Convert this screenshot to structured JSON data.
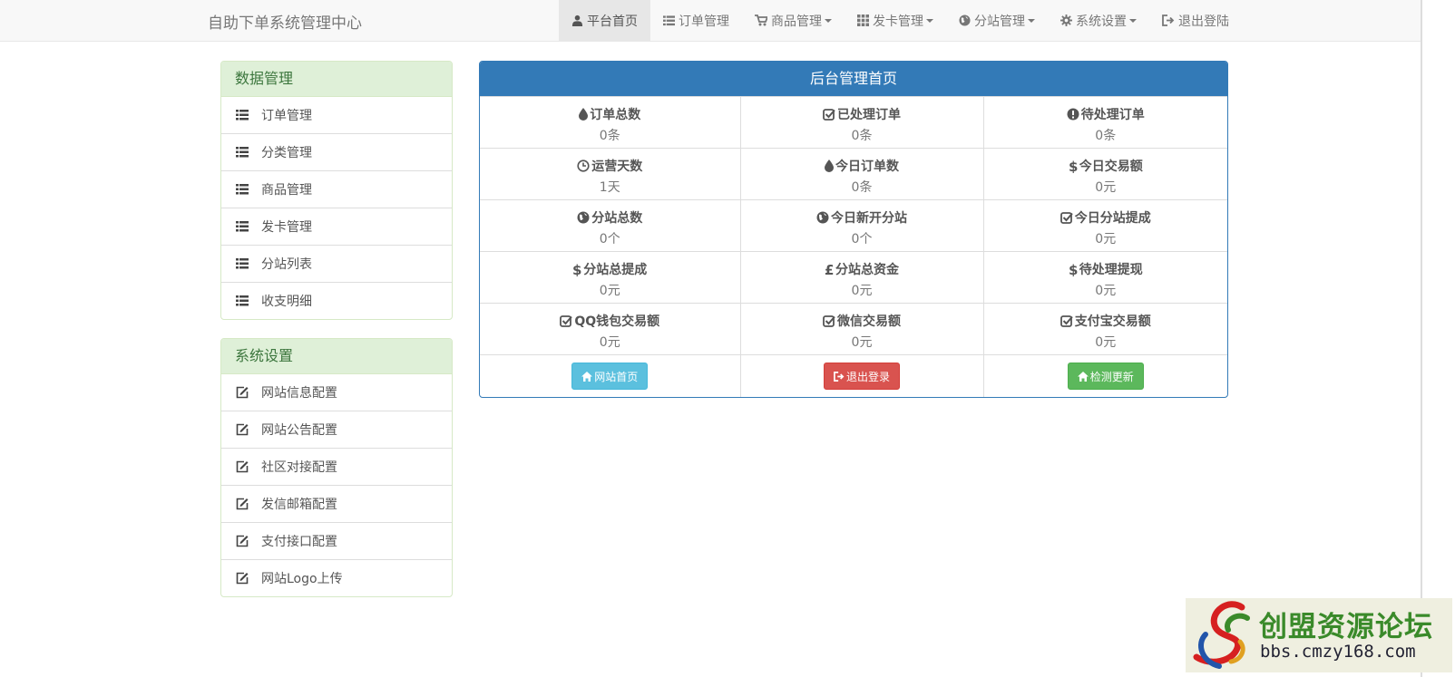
{
  "navbar": {
    "brand": "自助下单系统管理中心",
    "items": [
      {
        "label": "平台首页",
        "icon": "user-icon"
      },
      {
        "label": "订单管理",
        "icon": "list-icon"
      },
      {
        "label": "商品管理",
        "icon": "cart-icon"
      },
      {
        "label": "发卡管理",
        "icon": "grid-icon"
      },
      {
        "label": "分站管理",
        "icon": "globe-icon"
      },
      {
        "label": "系统设置",
        "icon": "gear-icon"
      },
      {
        "label": "退出登陆",
        "icon": "logout-icon"
      }
    ]
  },
  "sidebar": {
    "data_panel": {
      "title": "数据管理",
      "items": [
        {
          "label": "订单管理",
          "icon": "list-icon"
        },
        {
          "label": "分类管理",
          "icon": "list-icon"
        },
        {
          "label": "商品管理",
          "icon": "list-icon"
        },
        {
          "label": "发卡管理",
          "icon": "list-icon"
        },
        {
          "label": "分站列表",
          "icon": "list-icon"
        },
        {
          "label": "收支明细",
          "icon": "list-icon"
        }
      ]
    },
    "settings_panel": {
      "title": "系统设置",
      "items": [
        {
          "label": "网站信息配置",
          "icon": "edit-icon"
        },
        {
          "label": "网站公告配置",
          "icon": "edit-icon"
        },
        {
          "label": "社区对接配置",
          "icon": "edit-icon"
        },
        {
          "label": "发信邮箱配置",
          "icon": "edit-icon"
        },
        {
          "label": "支付接口配置",
          "icon": "edit-icon"
        },
        {
          "label": "网站Logo上传",
          "icon": "edit-icon"
        }
      ]
    }
  },
  "main": {
    "title": "后台管理首页",
    "rows": [
      [
        {
          "label": "订单总数",
          "value": "0条",
          "icon": "drop-icon"
        },
        {
          "label": "已处理订单",
          "value": "0条",
          "icon": "check-icon"
        },
        {
          "label": "待处理订单",
          "value": "0条",
          "icon": "info-icon"
        }
      ],
      [
        {
          "label": "运营天数",
          "value": "1天",
          "icon": "clock-icon"
        },
        {
          "label": "今日订单数",
          "value": "0条",
          "icon": "drop-icon"
        },
        {
          "label": "今日交易额",
          "value": "0元",
          "icon": "dollar-icon"
        }
      ],
      [
        {
          "label": "分站总数",
          "value": "0个",
          "icon": "globe-icon"
        },
        {
          "label": "今日新开分站",
          "value": "0个",
          "icon": "globe-icon"
        },
        {
          "label": "今日分站提成",
          "value": "0元",
          "icon": "check-icon"
        }
      ],
      [
        {
          "label": "分站总提成",
          "value": "0元",
          "icon": "dollar-icon"
        },
        {
          "label": "分站总资金",
          "value": "0元",
          "icon": "pound-icon"
        },
        {
          "label": "待处理提现",
          "value": "0元",
          "icon": "dollar-icon"
        }
      ],
      [
        {
          "label": "QQ钱包交易额",
          "value": "0元",
          "icon": "check-icon"
        },
        {
          "label": "微信交易额",
          "value": "0元",
          "icon": "check-icon"
        },
        {
          "label": "支付宝交易额",
          "value": "0元",
          "icon": "check-icon"
        }
      ]
    ],
    "buttons": {
      "home": "网站首页",
      "logout": "退出登录",
      "update": "检测更新"
    }
  },
  "watermark": {
    "name": "创盟资源论坛",
    "url": "bbs.cmzy168.com"
  },
  "colors": {
    "primary": "#337ab7",
    "success_bg": "#dff0d8",
    "success_text": "#3c763d",
    "info": "#5bc0de",
    "danger": "#d9534f",
    "success": "#5cb85c"
  }
}
